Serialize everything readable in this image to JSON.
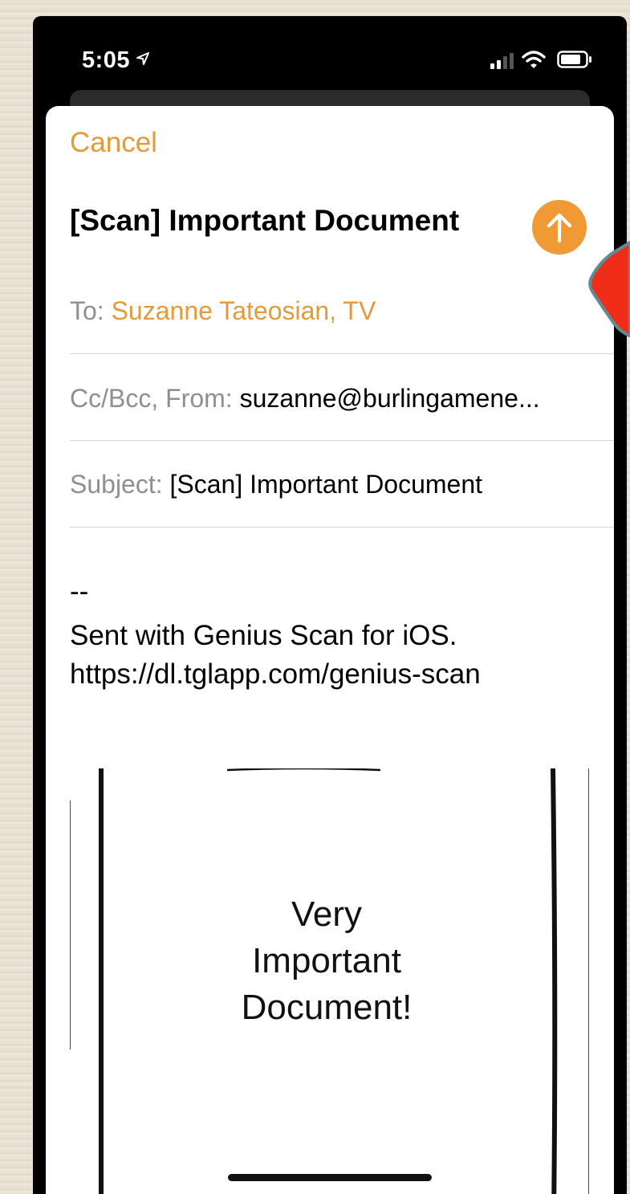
{
  "status_bar": {
    "time": "5:05",
    "icons": [
      "location-arrow-icon",
      "cellular-signal-icon",
      "wifi-icon",
      "battery-icon"
    ]
  },
  "compose": {
    "cancel_label": "Cancel",
    "title": "[Scan] Important Document",
    "send_icon": "arrow-up-icon",
    "to_label": "To:",
    "to_value": "Suzanne Tateosian, TV",
    "ccbcc_label": "Cc/Bcc, From:",
    "from_value": "suzanne@burlingamene...",
    "subject_label": "Subject:",
    "subject_value": "[Scan] Important Document",
    "body": {
      "separator": "--",
      "line1": "Sent with Genius Scan for iOS.",
      "line2": "https://dl.tglapp.com/genius-scan"
    },
    "attachment": {
      "line1": "Very",
      "line2": "Important",
      "line3": "Document!"
    }
  },
  "colors": {
    "accent": "#E39A3B",
    "send_button": "#F09A35",
    "callout": "#F02D18"
  }
}
